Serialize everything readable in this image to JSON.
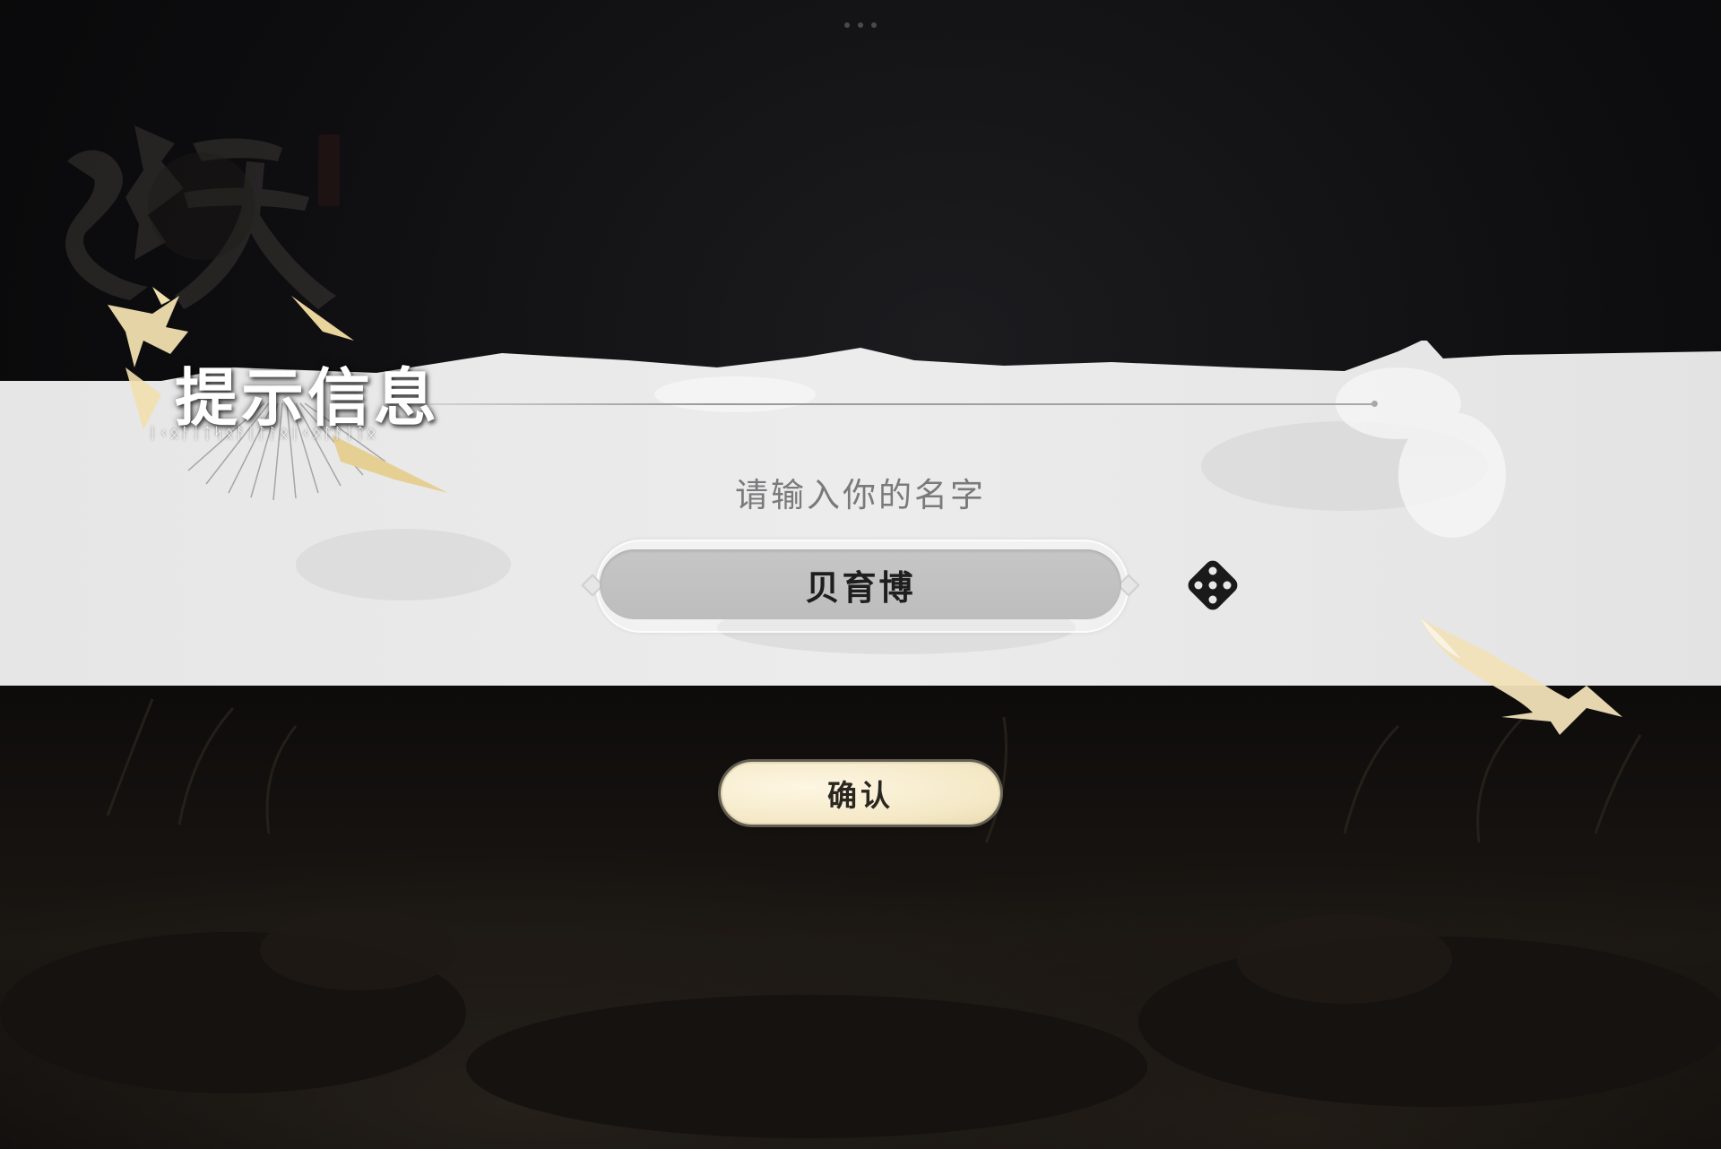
{
  "dialog": {
    "title": "提示信息",
    "prompt": "请输入你的名字",
    "name_value": "贝育博",
    "confirm_label": "确认"
  },
  "icons": {
    "dice": "dice-icon",
    "logo": "game-logo"
  },
  "colors": {
    "banner": "#e9e9e9",
    "confirm_bg": "#f6ecd0",
    "input_bg": "#c3c3c3",
    "background": "#0b0b0c",
    "gold_accent": "#f1dfae"
  }
}
